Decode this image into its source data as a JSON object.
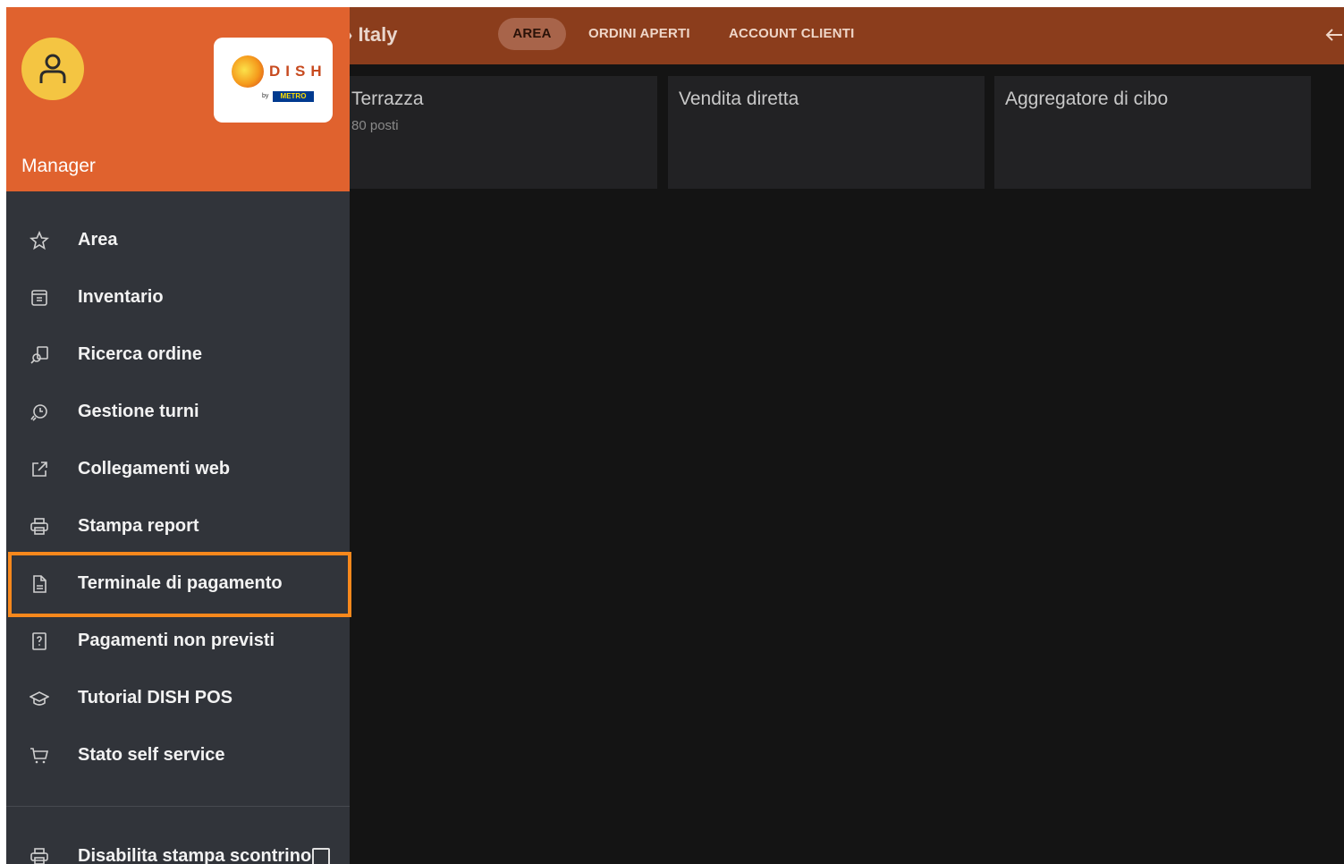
{
  "topbar": {
    "store_title": "› Italy",
    "tabs": [
      {
        "label": "AREA",
        "active": true
      },
      {
        "label": "ORDINI APERTI",
        "active": false
      },
      {
        "label": "ACCOUNT CLIENTI",
        "active": false
      }
    ],
    "back_icon": "arrow-left-icon"
  },
  "areas": [
    {
      "name": "Terrazza",
      "seats": "80 posti"
    },
    {
      "name": "Vendita diretta",
      "seats": ""
    },
    {
      "name": "Aggregatore di cibo",
      "seats": ""
    }
  ],
  "drawer": {
    "role": "Manager",
    "logo": {
      "brand": "DISH",
      "by": "by",
      "partner": "METRO"
    },
    "items": [
      {
        "label": "Area",
        "icon": "star-icon"
      },
      {
        "label": "Inventario",
        "icon": "inventory-icon"
      },
      {
        "label": "Ricerca ordine",
        "icon": "search-order-icon"
      },
      {
        "label": "Gestione turni",
        "icon": "shift-clock-icon"
      },
      {
        "label": "Collegamenti web",
        "icon": "external-link-icon"
      },
      {
        "label": "Stampa report",
        "icon": "printer-icon"
      },
      {
        "label": "Terminale di pagamento",
        "icon": "document-icon",
        "highlighted": true
      },
      {
        "label": "Pagamenti non previsti",
        "icon": "question-box-icon"
      },
      {
        "label": "Tutorial DISH POS",
        "icon": "graduation-cap-icon"
      },
      {
        "label": "Stato self service",
        "icon": "cart-icon"
      }
    ],
    "disable_receipt": {
      "label": "Disabilita stampa scontrino",
      "checked": false,
      "icon": "printer-icon"
    }
  },
  "colors": {
    "topbar": "#8b3d1c",
    "drawer_header": "#e0622e",
    "drawer_bg": "#31343a",
    "highlight": "#f7881c",
    "avatar": "#f4c542"
  }
}
